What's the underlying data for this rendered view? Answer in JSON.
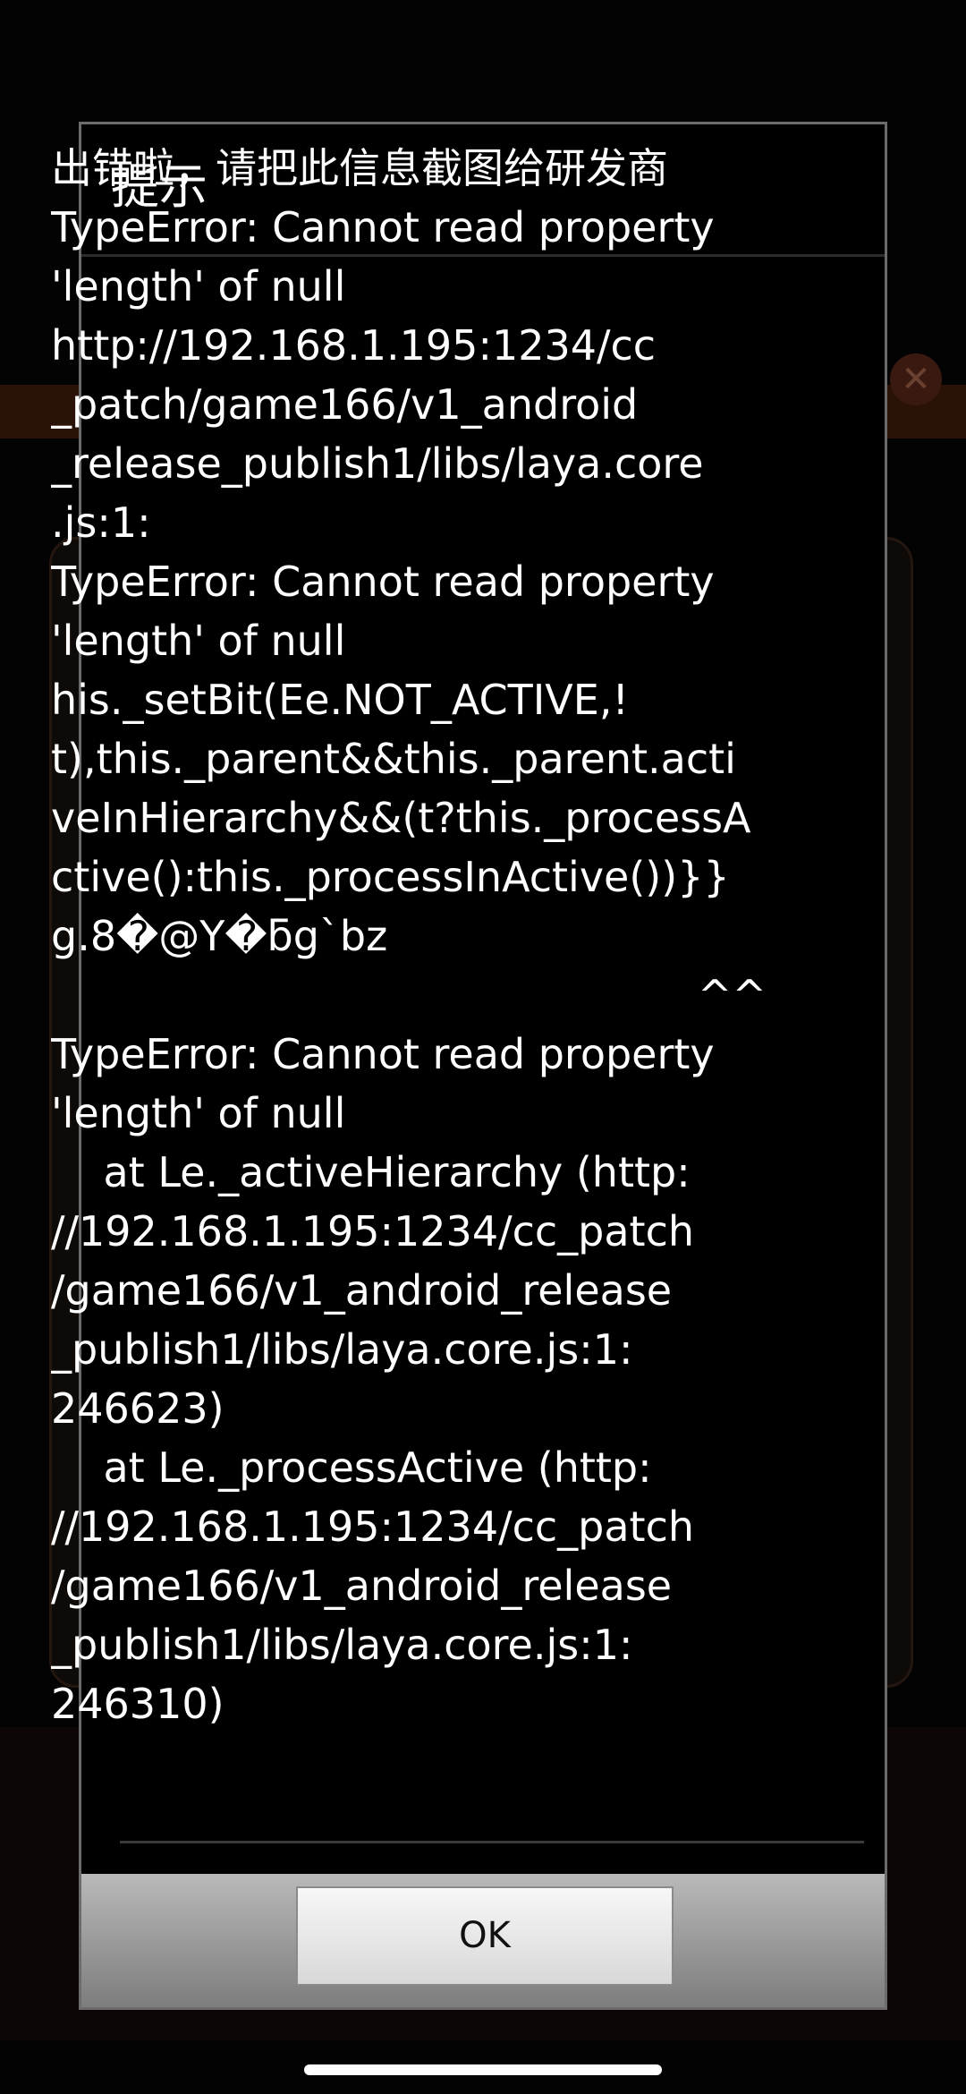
{
  "dialog": {
    "title": "提示",
    "message_lines": [
      "出错啦，请把此信息截图给研发商",
      "TypeError: Cannot read property",
      "'length' of null",
      "http://192.168.1.195:1234/cc",
      "_patch/game166/v1_android",
      "_release_publish1/libs/laya.core",
      ".js:1:",
      "TypeError: Cannot read property",
      "'length' of null",
      "his._setBit(Ee.NOT_ACTIVE,!",
      "t),this._parent&&this._parent.acti",
      "veInHierarchy&&(t?this._processA",
      "ctive():this._processInActive())}}",
      "g.8�@Y�ƃg`bz",
      "^^",
      "TypeError: Cannot read property",
      "'length' of null",
      "    at Le._activeHierarchy (http:",
      "//192.168.1.195:1234/cc_patch",
      "/game166/v1_android_release",
      "_publish1/libs/laya.core.js:1:",
      "246623)",
      "    at Le._processActive (http:",
      "//192.168.1.195:1234/cc_patch",
      "/game166/v1_android_release",
      "_publish1/libs/laya.core.js:1:",
      "246310)"
    ],
    "ok_label": "OK"
  },
  "colors": {
    "dialog_background": "#000000",
    "dialog_border": "#6b6b6b",
    "text": "#ffffff",
    "button_bar": "#9a9a9a",
    "button_face": "#e6e6e6"
  }
}
